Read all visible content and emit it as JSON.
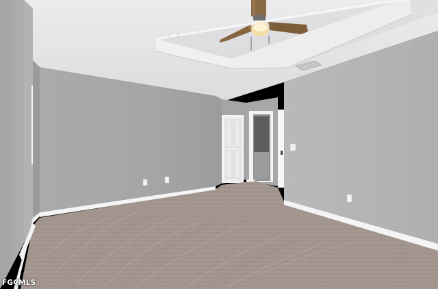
{
  "photo": {
    "subject": "empty-bedroom-interior",
    "watermark": "FGCMLS",
    "colors": {
      "wall_left": "#a6a7a9",
      "wall_back": "#a8a9ab",
      "wall_right": "#b3b4b6",
      "ceiling": "#e6e6e8",
      "carpet": "#a69a91",
      "baseboard": "#f3f3f3",
      "fan_wood": "#8a6a44",
      "fan_light": "#f4dca8"
    }
  }
}
